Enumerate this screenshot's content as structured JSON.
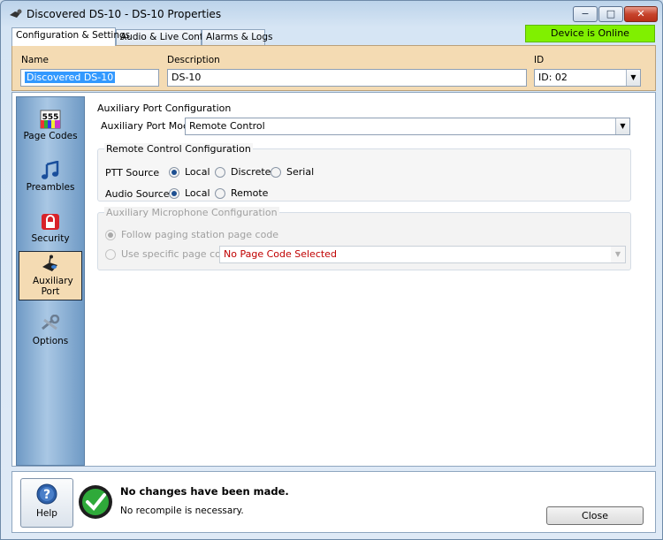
{
  "window": {
    "title": "Discovered DS-10 - DS-10 Properties",
    "controls": {
      "minimize": "−",
      "maximize": "□",
      "close": "✕"
    }
  },
  "tabs": [
    {
      "label": "Configuration & Settings",
      "active": true
    },
    {
      "label": "Audio & Live Control",
      "active": false
    },
    {
      "label": "Alarms & Logs",
      "active": false
    }
  ],
  "status": {
    "text": "Device is Online",
    "color": "#80f000"
  },
  "info": {
    "name_label": "Name",
    "name_value": "Discovered DS-10",
    "description_label": "Description",
    "description_value": "DS-10",
    "id_label": "ID",
    "id_value": "ID: 02"
  },
  "sidebar": {
    "items": [
      {
        "label": "Page Codes",
        "icon": "page-codes-icon",
        "icon_text": "555",
        "active": false
      },
      {
        "label": "Preambles",
        "icon": "music-note-icon",
        "active": false
      },
      {
        "label": "Security",
        "icon": "lock-icon",
        "active": false
      },
      {
        "label": "Auxiliary Port",
        "icon": "microphone-icon",
        "active": true
      },
      {
        "label": "Options",
        "icon": "wrench-icon",
        "active": false
      }
    ]
  },
  "aux": {
    "section_title": "Auxiliary Port Configuration",
    "mode_label": "Auxiliary Port Mode",
    "mode_value": "Remote Control",
    "remote": {
      "title": "Remote Control Configuration",
      "ptt_label": "PTT Source",
      "ptt_options": [
        "Local",
        "Discrete",
        "Serial"
      ],
      "ptt_selected": "Local",
      "audio_label": "Audio Source",
      "audio_options": [
        "Local",
        "Remote"
      ],
      "audio_selected": "Local"
    },
    "mic": {
      "title": "Auxiliary Microphone Configuration",
      "option_follow": "Follow paging station page code",
      "option_specific": "Use specific page code",
      "page_code_value": "No Page Code Selected",
      "page_code_color": "#c00000",
      "selected": "follow",
      "enabled": false
    }
  },
  "footer": {
    "help_label": "Help",
    "status_title": "No changes have been made.",
    "status_detail": "No recompile is necessary.",
    "close_label": "Close"
  }
}
